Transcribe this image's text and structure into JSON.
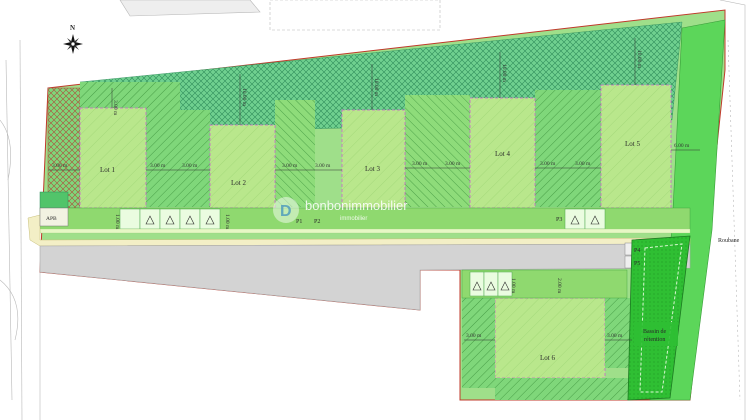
{
  "compass": {
    "letter": "N"
  },
  "lots": [
    {
      "id": "lot1",
      "label": "Lot 1"
    },
    {
      "id": "lot2",
      "label": "Lot 2"
    },
    {
      "id": "lot3",
      "label": "Lot 3"
    },
    {
      "id": "lot4",
      "label": "Lot 4"
    },
    {
      "id": "lot5",
      "label": "Lot 5"
    },
    {
      "id": "lot6",
      "label": "Lot 6"
    }
  ],
  "parking": {
    "apb": "APB",
    "p1": "P1",
    "p2": "P2",
    "p3": "P3",
    "p4": "P4",
    "p5": "P5"
  },
  "road_label": "Roubane",
  "basin": {
    "line1": "Bassin de",
    "line2": "rétention"
  },
  "watermark": {
    "main": "bonbonimmobilier",
    "sub": "immobilier"
  },
  "dimensions": {
    "d300": "3.00 m",
    "d600": "6.00 m",
    "d1000": "10.00 m",
    "d1200": "12.00 m",
    "d200": "2.00 m",
    "d100": "1.00 m"
  },
  "colors": {
    "green_light": "#9fdf8a",
    "green_mid": "#6cd56e",
    "green_bright": "#39c43c",
    "road": "#d3d3d3",
    "sidewalk": "#f3efc6",
    "border_red": "#c0392b",
    "lot_dashed": "#cc66cc"
  }
}
